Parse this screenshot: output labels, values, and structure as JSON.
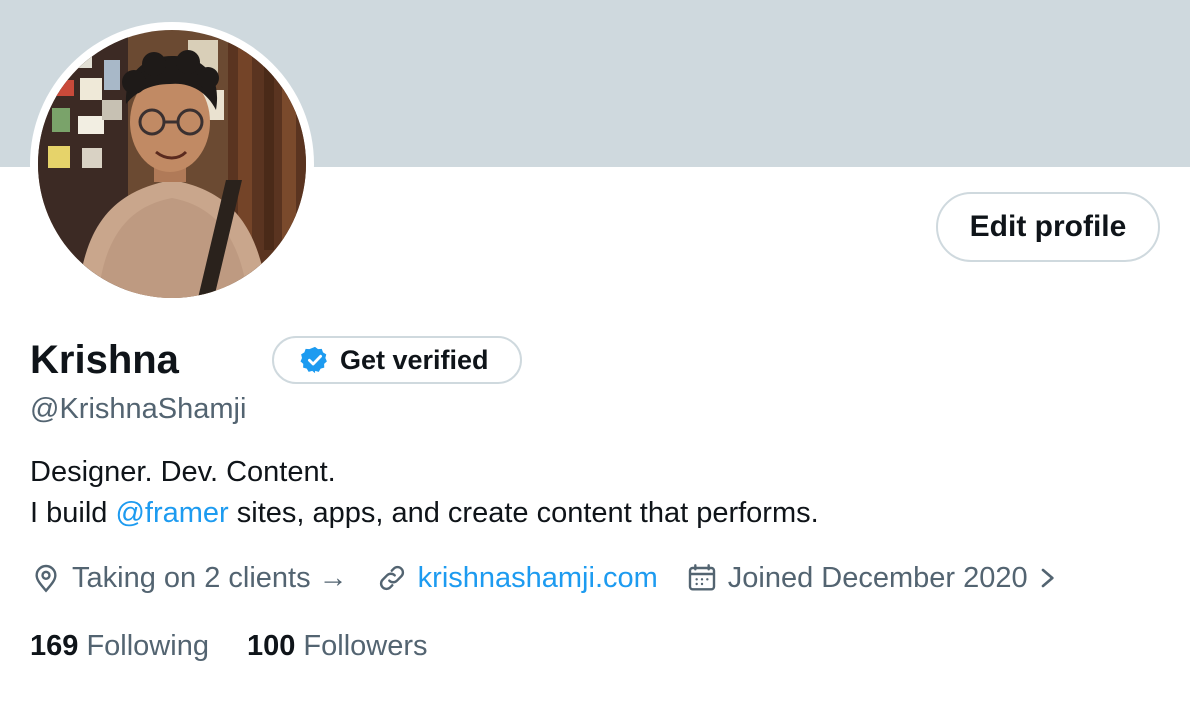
{
  "profile": {
    "name": "Krishna",
    "handle": "@KrishnaShamji",
    "edit_profile_label": "Edit profile",
    "get_verified_label": "Get verified",
    "bio": {
      "line1": "Designer. Dev. Content.",
      "line2_prefix": "I build ",
      "mention": "@framer",
      "line2_suffix": " sites, apps, and create content that performs."
    },
    "meta": {
      "location": "Taking on 2 clients →",
      "website": "krishnashamji.com",
      "joined": "Joined December 2020"
    },
    "stats": {
      "following_count": "169",
      "following_label": "Following",
      "followers_count": "100",
      "followers_label": "Followers"
    }
  },
  "icons": {
    "verified_badge": "verified-badge-icon",
    "location": "location-pin-icon",
    "link": "link-icon",
    "calendar": "calendar-icon",
    "chevron": "chevron-right-icon"
  },
  "colors": {
    "banner": "#cfd9de",
    "accent": "#1d9bf0",
    "text_primary": "#0f1419",
    "text_secondary": "#536471",
    "border": "#cfd9de"
  }
}
